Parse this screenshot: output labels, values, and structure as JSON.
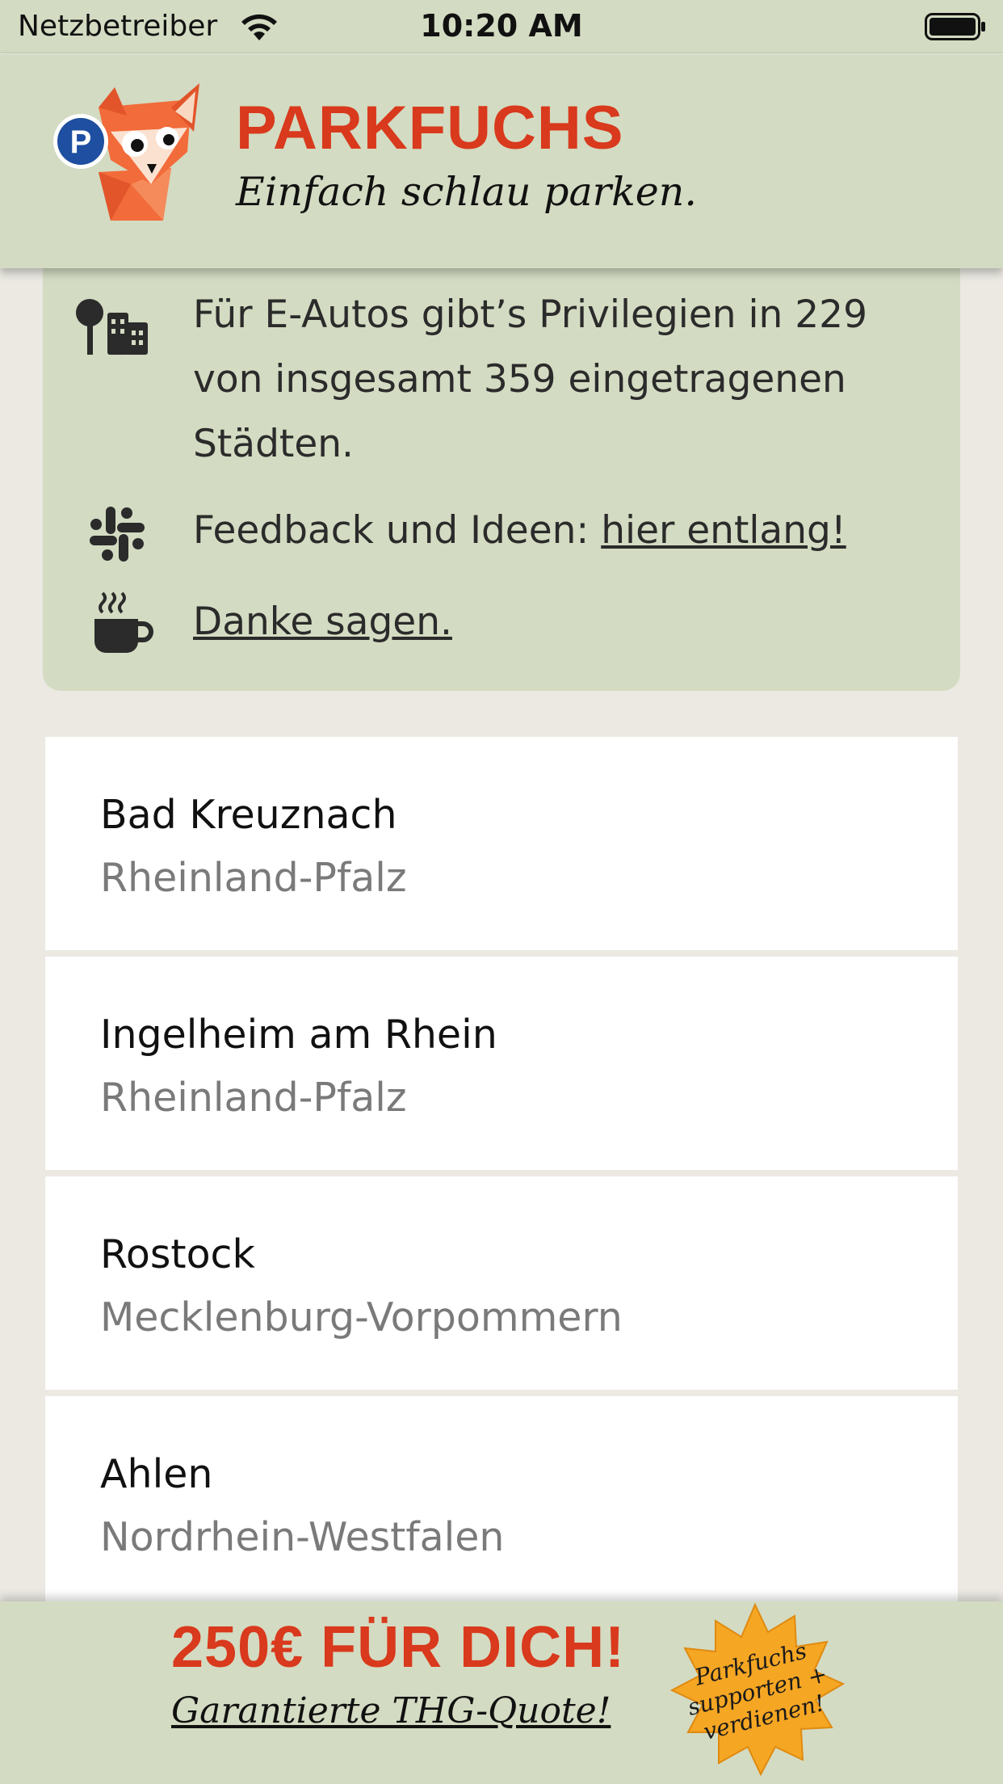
{
  "status_bar": {
    "carrier": "Netzbetreiber",
    "time": "10:20 AM"
  },
  "header": {
    "title": "PARKFUCHS",
    "tagline": "Einfach schlau parken."
  },
  "info": {
    "privileges_text": "Für E-Autos gibt’s Privilegien in 229 von insgesamt 359 eingetragenen Städten.",
    "feedback_prefix": "Feedback und Ideen: ",
    "feedback_link": "hier entlang!",
    "thanks_link": "Danke sagen."
  },
  "cities": [
    {
      "name": "Bad Kreuznach",
      "state": "Rheinland-Pfalz"
    },
    {
      "name": "Ingelheim am Rhein",
      "state": "Rheinland-Pfalz"
    },
    {
      "name": "Rostock",
      "state": "Mecklenburg-Vorpommern"
    },
    {
      "name": "Ahlen",
      "state": "Nordrhein-Westfalen"
    }
  ],
  "banner": {
    "headline": "250€ FÜR DICH!",
    "subline": "Garantierte THG-Quote!",
    "badge_line1": "Parkfuchs",
    "badge_line2": "supporten +",
    "badge_line3": "verdienen!"
  },
  "colors": {
    "header_bg": "#d3dbc2",
    "brand_red": "#d9391c",
    "page_bg": "#ebe9e2",
    "badge_orange": "#f5a623"
  },
  "icons": [
    "wifi-icon",
    "battery-icon",
    "fox-logo",
    "city-icon",
    "slack-icon",
    "coffee-icon"
  ]
}
